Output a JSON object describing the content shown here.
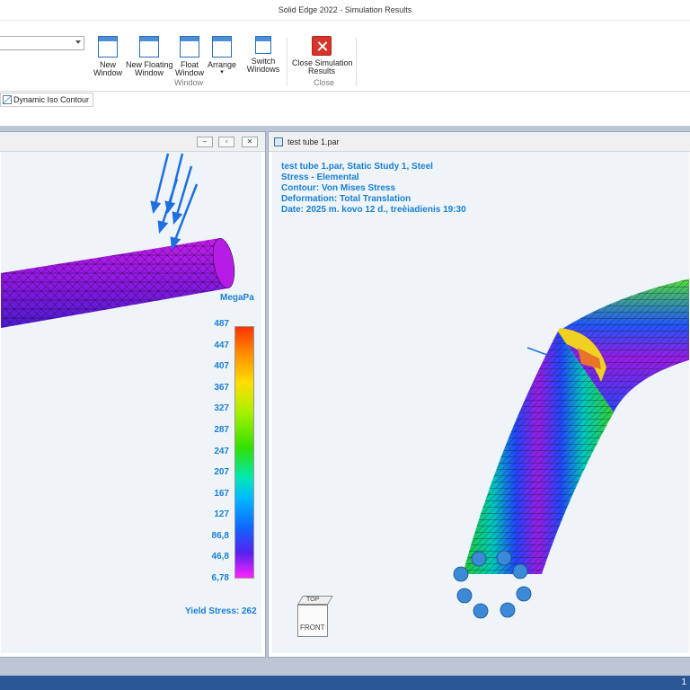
{
  "app": {
    "title": "Solid Edge 2022 - Simulation Results"
  },
  "ribbon": {
    "buttons": {
      "new_window": "New\nWindow",
      "new_floating_window": "New Floating\nWindow",
      "float_window": "Float\nWindow",
      "arrange": "Arrange",
      "switch_windows": "Switch\nWindows",
      "close_sim": "Close Simulation\nResults"
    },
    "groups": {
      "window": "Window",
      "close": "Close"
    },
    "combo_value": ""
  },
  "toolbar": {
    "iso_label": "Dynamic Iso Contour"
  },
  "left_window": {
    "legend_unit": "MegaPa",
    "ticks": [
      "487",
      "447",
      "407",
      "367",
      "327",
      "287",
      "247",
      "207",
      "167",
      "127",
      "86,8",
      "46,8",
      "6,78"
    ],
    "yield_label": "Yield Stress: 262"
  },
  "right_window": {
    "tab_title": "test tube 1.par",
    "info_lines": [
      "test tube 1.par, Static Study 1, Steel",
      "Stress - Elemental",
      "Contour: Von Mises Stress",
      "Deformation: Total Translation",
      "Date: 2025 m. kovo 12 d., treèiadienis  19:30"
    ],
    "cube": {
      "front": "FRONT",
      "top": "TOP"
    }
  },
  "status": {
    "page": "1"
  },
  "colors": {
    "accent": "#1a7fd4",
    "status_bar": "#2b5797",
    "close_red": "#d9342b"
  }
}
